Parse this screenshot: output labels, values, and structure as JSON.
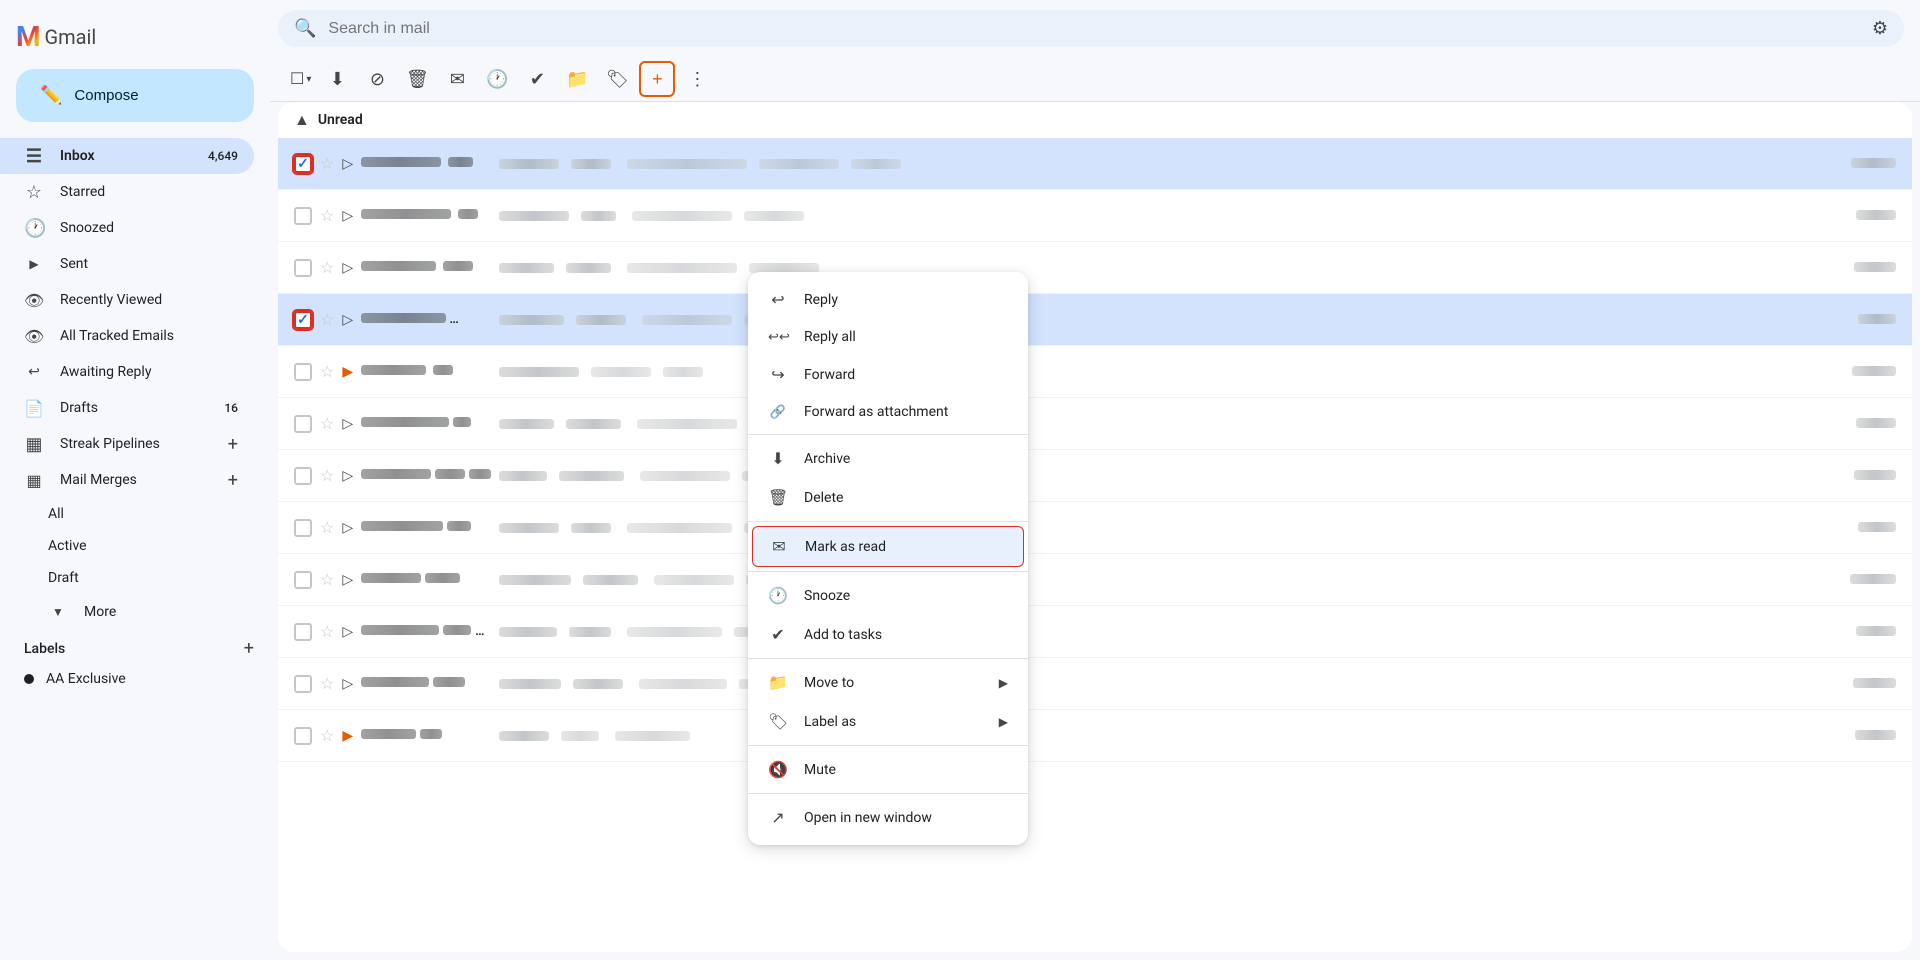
{
  "sidebar": {
    "compose_label": "Compose",
    "nav_items": [
      {
        "id": "inbox",
        "label": "Inbox",
        "icon": "☰",
        "count": "4,649",
        "active": true
      },
      {
        "id": "starred",
        "label": "Starred",
        "icon": "☆",
        "count": ""
      },
      {
        "id": "snoozed",
        "label": "Snoozed",
        "icon": "🕐",
        "count": ""
      },
      {
        "id": "sent",
        "label": "Sent",
        "icon": "▷",
        "count": "",
        "collapsible": true
      },
      {
        "id": "recently-viewed",
        "label": "Recently Viewed",
        "icon": "👁",
        "count": ""
      },
      {
        "id": "all-tracked",
        "label": "All Tracked Emails",
        "icon": "👁",
        "count": ""
      },
      {
        "id": "awaiting-reply",
        "label": "Awaiting Reply",
        "icon": "↩",
        "count": ""
      }
    ],
    "drafts_label": "Drafts",
    "drafts_count": "16",
    "streak_label": "Streak Pipelines",
    "streak_add": "+",
    "mail_merges_label": "Mail Merges",
    "mail_merges_add": "+",
    "sub_items": [
      {
        "label": "All"
      },
      {
        "label": "Active"
      },
      {
        "label": "Draft"
      },
      {
        "label": "More",
        "collapsible": true
      }
    ],
    "labels_title": "Labels",
    "labels_add": "+",
    "label_items": [
      {
        "label": "AA Exclusive",
        "color": "#202124"
      }
    ]
  },
  "search": {
    "placeholder": "Search in mail"
  },
  "toolbar": {
    "buttons": [
      {
        "id": "select",
        "icon": "☐",
        "label": "Select"
      },
      {
        "id": "archive",
        "icon": "⬇",
        "label": "Archive"
      },
      {
        "id": "report-spam",
        "icon": "⊘",
        "label": "Report spam"
      },
      {
        "id": "delete",
        "icon": "🗑",
        "label": "Delete"
      },
      {
        "id": "mark-unread",
        "icon": "✉",
        "label": "Mark as unread"
      },
      {
        "id": "snooze",
        "icon": "🕐",
        "label": "Snooze"
      },
      {
        "id": "add-to-tasks",
        "icon": "✓",
        "label": "Add to tasks"
      },
      {
        "id": "move-to",
        "icon": "📁",
        "label": "Move to"
      },
      {
        "id": "labels",
        "icon": "🏷",
        "label": "Labels"
      },
      {
        "id": "add-label",
        "icon": "➕",
        "label": "Add label"
      },
      {
        "id": "more",
        "icon": "⋮",
        "label": "More"
      }
    ]
  },
  "section_header": "Unread",
  "context_menu": {
    "items": [
      {
        "id": "reply",
        "icon": "↩",
        "label": "Reply",
        "has_arrow": false
      },
      {
        "id": "reply-all",
        "icon": "↩↩",
        "label": "Reply all",
        "has_arrow": false
      },
      {
        "id": "forward",
        "icon": "↪",
        "label": "Forward",
        "has_arrow": false
      },
      {
        "id": "forward-attachment",
        "icon": "📎",
        "label": "Forward as attachment",
        "has_arrow": false
      },
      {
        "id": "archive",
        "icon": "⬇",
        "label": "Archive",
        "has_arrow": false
      },
      {
        "id": "delete",
        "icon": "🗑",
        "label": "Delete",
        "has_arrow": false
      },
      {
        "id": "mark-as-read",
        "icon": "✉",
        "label": "Mark as read",
        "highlighted": true,
        "has_arrow": false
      },
      {
        "id": "snooze",
        "icon": "🕐",
        "label": "Snooze",
        "has_arrow": false
      },
      {
        "id": "add-to-tasks",
        "icon": "✓",
        "label": "Add to tasks",
        "has_arrow": false
      },
      {
        "id": "move-to",
        "icon": "📁",
        "label": "Move to",
        "has_arrow": true
      },
      {
        "id": "label-as",
        "icon": "🏷",
        "label": "Label as",
        "has_arrow": true
      },
      {
        "id": "mute",
        "icon": "🔇",
        "label": "Mute",
        "has_arrow": false
      },
      {
        "id": "open-new-window",
        "icon": "⬡",
        "label": "Open in new window",
        "has_arrow": false
      }
    ],
    "dividers_after": [
      3,
      5,
      6,
      8,
      10,
      11
    ]
  },
  "emails": [
    {
      "id": 1,
      "checked": true,
      "starred": false,
      "forwarded": false,
      "highlighted": true
    },
    {
      "id": 2,
      "checked": false,
      "starred": false,
      "forwarded": false,
      "highlighted": false
    },
    {
      "id": 3,
      "checked": false,
      "starred": false,
      "forwarded": false,
      "highlighted": false
    },
    {
      "id": 4,
      "checked": true,
      "starred": false,
      "forwarded": false,
      "highlighted": true
    },
    {
      "id": 5,
      "checked": false,
      "starred": false,
      "forwarded": true,
      "orange": true,
      "highlighted": false
    },
    {
      "id": 6,
      "checked": false,
      "starred": false,
      "forwarded": false,
      "highlighted": false
    },
    {
      "id": 7,
      "checked": false,
      "starred": false,
      "forwarded": false,
      "highlighted": false
    },
    {
      "id": 8,
      "checked": false,
      "starred": false,
      "forwarded": false,
      "highlighted": false
    },
    {
      "id": 9,
      "checked": false,
      "starred": false,
      "forwarded": false,
      "highlighted": false
    },
    {
      "id": 10,
      "checked": false,
      "starred": false,
      "forwarded": false,
      "highlighted": false
    },
    {
      "id": 11,
      "checked": false,
      "starred": false,
      "forwarded": false,
      "highlighted": false
    },
    {
      "id": 12,
      "checked": false,
      "starred": false,
      "forwarded": true,
      "orange": true,
      "highlighted": false
    }
  ]
}
